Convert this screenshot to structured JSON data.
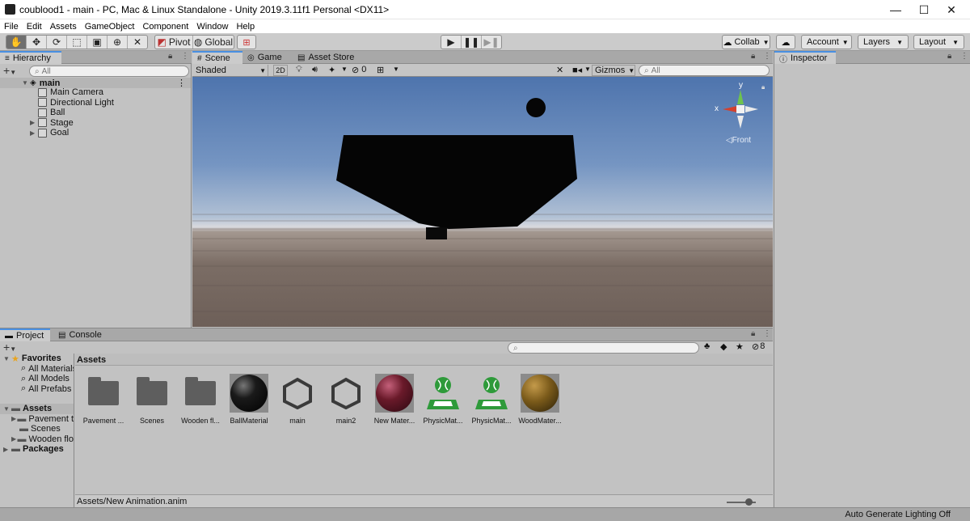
{
  "window": {
    "title": "coublood1 - main - PC, Mac & Linux Standalone - Unity 2019.3.11f1 Personal <DX11>",
    "controls": [
      "—",
      "☐",
      "✕"
    ]
  },
  "menu": [
    "File",
    "Edit",
    "Assets",
    "GameObject",
    "Component",
    "Window",
    "Help"
  ],
  "toolbar": {
    "pivot_label": "Pivot",
    "global_label": "Global",
    "collab_label": "Collab",
    "account_label": "Account",
    "layers_label": "Layers",
    "layout_label": "Layout"
  },
  "hierarchy": {
    "tab": "Hierarchy",
    "search_placeholder": "All",
    "scene": "main",
    "items": [
      {
        "label": "Main Camera",
        "expandable": false
      },
      {
        "label": "Directional Light",
        "expandable": false
      },
      {
        "label": "Ball",
        "expandable": false
      },
      {
        "label": "Stage",
        "expandable": true
      },
      {
        "label": "Goal",
        "expandable": true
      }
    ]
  },
  "scene": {
    "tabs": [
      "Scene",
      "Game",
      "Asset Store"
    ],
    "shading_mode": "Shaded",
    "mode_2d": "2D",
    "hidden_count": "0",
    "gizmos_label": "Gizmos",
    "search_placeholder": "All",
    "gizmo_x": "x",
    "gizmo_y": "y",
    "view_label": "Front"
  },
  "inspector": {
    "tab": "Inspector"
  },
  "project": {
    "tabs": [
      "Project",
      "Console"
    ],
    "favorites_label": "Favorites",
    "favorites": [
      "All Materials",
      "All Models",
      "All Prefabs"
    ],
    "assets_label": "Assets",
    "asset_folders": [
      "Pavement t",
      "Scenes",
      "Wooden flo"
    ],
    "packages_label": "Packages",
    "breadcrumb": "Assets",
    "hidden_count": "8",
    "assets": [
      {
        "label": "Pavement ...",
        "kind": "folder"
      },
      {
        "label": "Scenes",
        "kind": "folder"
      },
      {
        "label": "Wooden fl...",
        "kind": "folder"
      },
      {
        "label": "BallMaterial",
        "kind": "material",
        "color": "#1a1a1a"
      },
      {
        "label": "main",
        "kind": "scene"
      },
      {
        "label": "main2",
        "kind": "scene"
      },
      {
        "label": "New Mater...",
        "kind": "material",
        "color": "#6a1a2a"
      },
      {
        "label": "PhysicMat...",
        "kind": "physic"
      },
      {
        "label": "PhysicMat...",
        "kind": "physic"
      },
      {
        "label": "WoodMater...",
        "kind": "material",
        "color": "#7a5a1a"
      }
    ],
    "selected_path": "Assets/New Animation.anim"
  },
  "status": {
    "lighting": "Auto Generate Lighting Off"
  },
  "colors": {
    "accent": "#4a90e2",
    "physic_green": "#2e9a3a"
  }
}
